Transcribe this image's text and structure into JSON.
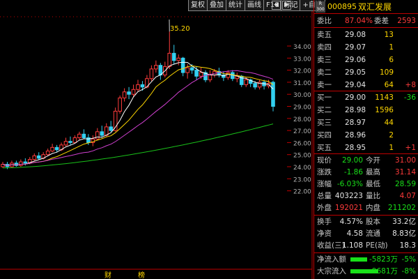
{
  "toolbar": {
    "buttons": [
      "复权",
      "叠加",
      "统计",
      "画线",
      "F10",
      "标记",
      "+自选"
    ],
    "window_icons": [
      "◀",
      "▶"
    ]
  },
  "chart": {
    "price_axis": [
      "34.00",
      "33.00",
      "32.00",
      "31.00",
      "30.00",
      "29.00",
      "28.00",
      "27.00",
      "26.00",
      "25.00",
      "24.00",
      "23.00",
      "22.00"
    ],
    "high_marker": "35.20",
    "bottom_markers": [
      "财",
      "榜"
    ],
    "colors": {
      "up": "#ff3b3b",
      "down": "#33d0f0",
      "ma5": "#ffffff",
      "ma10": "#ffd700",
      "ma20": "#d040d0",
      "ma60": "#19c019",
      "grid": "#c00000"
    }
  },
  "panel": {
    "code": "000895",
    "name": "双汇发展",
    "badge": "R 300",
    "weibi": {
      "label": "委比",
      "value": "87.04%",
      "label2": "委差",
      "value2": "2593"
    },
    "asks": [
      {
        "label": "卖五",
        "price": "29.08",
        "volume": "13",
        "change": ""
      },
      {
        "label": "卖四",
        "price": "29.07",
        "volume": "1",
        "change": ""
      },
      {
        "label": "卖三",
        "price": "29.06",
        "volume": "6",
        "change": ""
      },
      {
        "label": "卖二",
        "price": "29.05",
        "volume": "109",
        "change": ""
      },
      {
        "label": "卖一",
        "price": "29.04",
        "volume": "64",
        "change": "+8"
      }
    ],
    "bids": [
      {
        "label": "买一",
        "price": "29.00",
        "volume": "1143",
        "change": "-36"
      },
      {
        "label": "买二",
        "price": "28.98",
        "volume": "1596",
        "change": ""
      },
      {
        "label": "买三",
        "price": "28.97",
        "volume": "44",
        "change": ""
      },
      {
        "label": "买四",
        "price": "28.96",
        "volume": "2",
        "change": ""
      },
      {
        "label": "买五",
        "price": "28.95",
        "volume": "1",
        "change": "+1"
      }
    ],
    "stats": [
      {
        "l1": "现价",
        "v1": "29.00",
        "l2": "今开",
        "v2": "31.00"
      },
      {
        "l1": "涨跌",
        "v1": "-1.86",
        "l2": "最高",
        "v2": "31.14"
      },
      {
        "l1": "涨幅",
        "v1": "-6.03%",
        "l2": "最低",
        "v2": "28.59"
      },
      {
        "l1": "总量",
        "v1": "403223",
        "l2": "量比",
        "v2": "4.07"
      },
      {
        "l1": "外盘",
        "v1": "192021",
        "l2": "内盘",
        "v2": "211202"
      }
    ],
    "fundamentals": [
      {
        "l1": "换手",
        "v1": "4.57%",
        "l2": "股本",
        "v2": "33.2亿"
      },
      {
        "l1": "净资",
        "v1": "4.58",
        "l2": "流通",
        "v2": "8.83亿"
      },
      {
        "l1": "收益(三)",
        "v1": "1.108",
        "l2": "PE(动)",
        "v2": "18.3"
      }
    ],
    "flows": [
      {
        "label": "净流入额",
        "value": "-5823万",
        "pct": "-5%"
      },
      {
        "label": "大宗流入",
        "value": "-9681万",
        "pct": "-8%"
      }
    ]
  }
}
